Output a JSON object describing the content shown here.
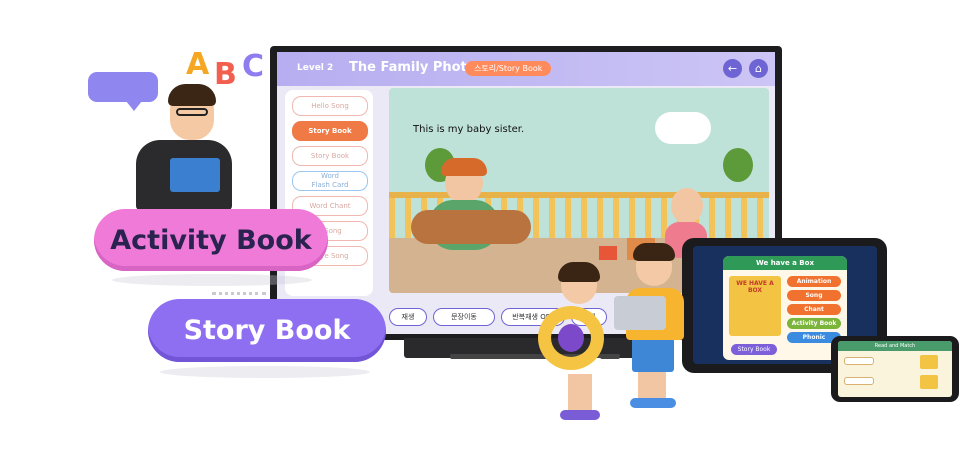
{
  "letters": [
    "A",
    "B",
    "C"
  ],
  "colors": {
    "letter_a": "#f5a623",
    "letter_b": "#f25f4f",
    "letter_c": "#8e7cf0",
    "activity_pill": "#f07ad8",
    "story_pill": "#8e6ff2",
    "accent": "#6e64d4"
  },
  "tv": {
    "level": "Level 2",
    "book_title": "The Family Photo",
    "badge": "스토리/Story Book",
    "back_icon": "back-arrow-icon",
    "home_icon": "home-icon",
    "menu": [
      {
        "label": "Hello Song",
        "state": "inactive"
      },
      {
        "label": "Story Book",
        "state": "active"
      },
      {
        "label": "Story Book",
        "state": "inactive"
      },
      {
        "label": "Word\nFlash Card",
        "state": "blue"
      },
      {
        "label": "Word Chant",
        "state": "inactive"
      },
      {
        "label": "s Song",
        "state": "inactive"
      },
      {
        "label": "dbye Song",
        "state": "inactive"
      }
    ],
    "caption": "This is my baby sister.",
    "controls": {
      "play": "재생",
      "sentence_move": "문장이동",
      "repeat": "반복재생 OFF",
      "extra": "재생"
    }
  },
  "pills": {
    "activity_book": "Activity Book",
    "story_book": "Story Book"
  },
  "tablet": {
    "banner": "We have a Box",
    "book_title": "WE HAVE A BOX",
    "buttons": [
      {
        "label": "Animation",
        "color": "#f0722e"
      },
      {
        "label": "Song",
        "color": "#f0722e"
      },
      {
        "label": "Chant",
        "color": "#f0722e"
      },
      {
        "label": "Activity Book",
        "color": "#7bb43a"
      },
      {
        "label": "Phonic",
        "color": "#3b8be0"
      }
    ],
    "story_button": "Story Book"
  },
  "phone": {
    "header": "Read and Match"
  }
}
